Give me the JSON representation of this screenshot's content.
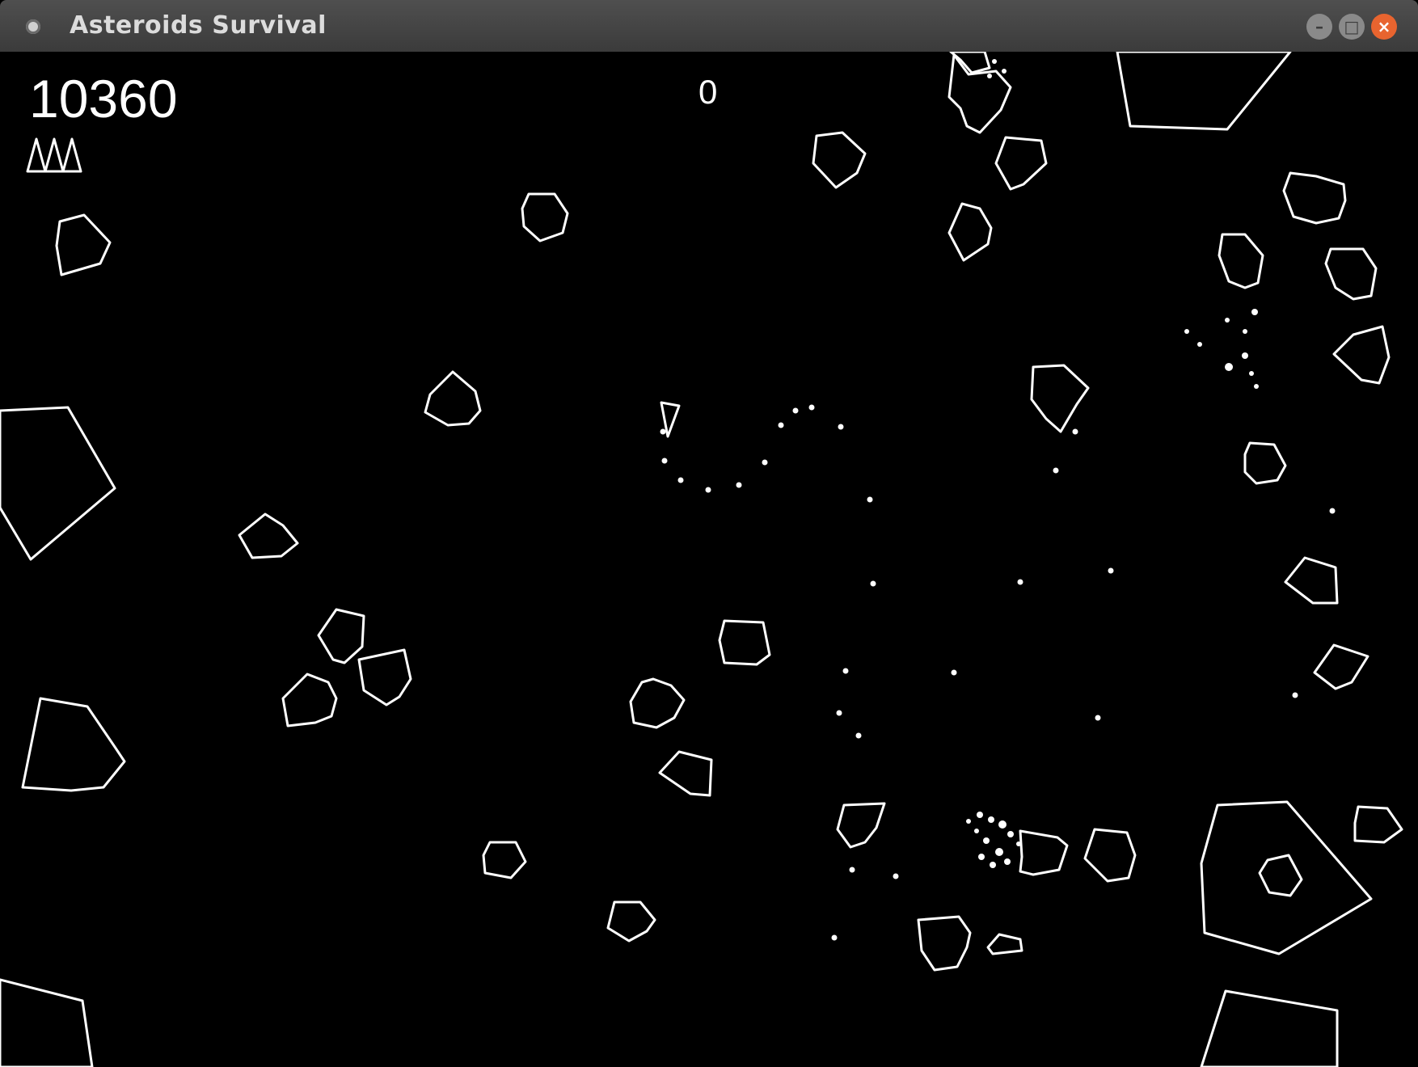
{
  "window": {
    "title": "Asteroids Survival"
  },
  "hud": {
    "score": "10360",
    "secondary_score": "0",
    "lives": 3
  },
  "colors": {
    "background": "#000000",
    "stroke": "#ffffff",
    "titlebar": "#444444",
    "close": "#e8642f"
  },
  "window_buttons": {
    "minimize": "–",
    "maximize": "□",
    "close": "×"
  }
}
